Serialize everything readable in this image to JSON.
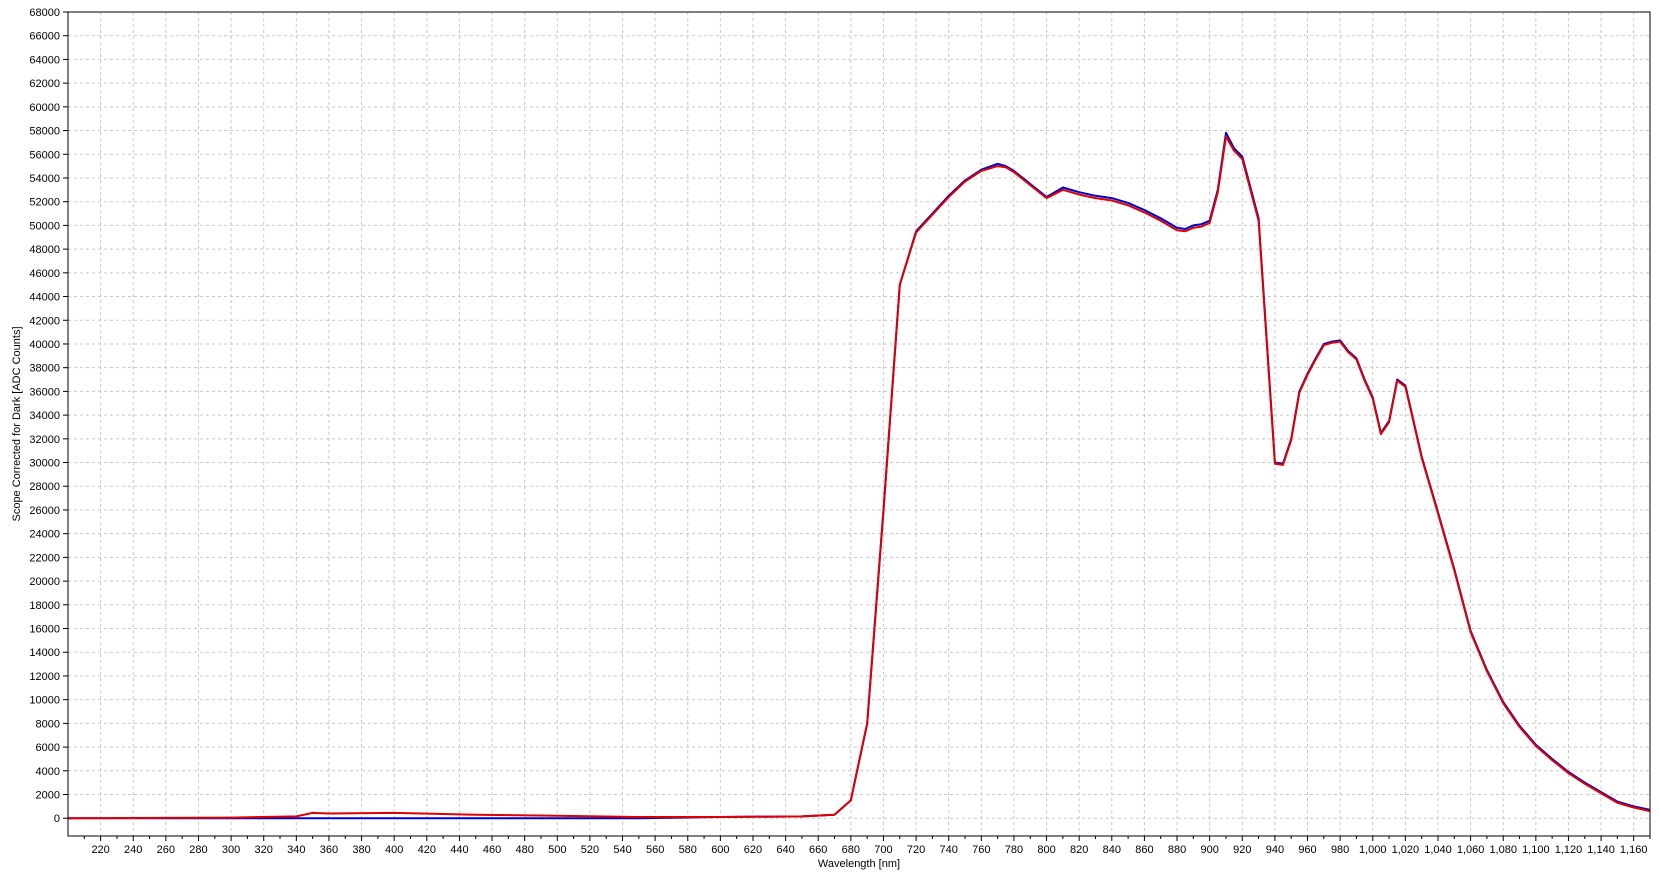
{
  "chart_data": {
    "type": "line",
    "title": "",
    "xlabel": "Wavelength [nm]",
    "ylabel": "Scope Corrected for Dark [ADC Counts]",
    "xlim": [
      200,
      1170
    ],
    "ylim": [
      -1500,
      68000
    ],
    "grid": true,
    "legend": "none",
    "x_ticks": [
      "220",
      "240",
      "260",
      "280",
      "300",
      "320",
      "340",
      "360",
      "380",
      "400",
      "420",
      "440",
      "460",
      "480",
      "500",
      "520",
      "540",
      "560",
      "580",
      "600",
      "620",
      "640",
      "660",
      "680",
      "700",
      "720",
      "740",
      "760",
      "780",
      "800",
      "820",
      "840",
      "860",
      "880",
      "900",
      "920",
      "940",
      "960",
      "980",
      "1,000",
      "1,020",
      "1,040",
      "1,060",
      "1,080",
      "1,100",
      "1,120",
      "1,140",
      "1,160"
    ],
    "y_ticks": [
      "0",
      "2000",
      "4000",
      "6000",
      "8000",
      "10000",
      "12000",
      "14000",
      "16000",
      "18000",
      "20000",
      "22000",
      "24000",
      "26000",
      "28000",
      "30000",
      "32000",
      "34000",
      "36000",
      "38000",
      "40000",
      "42000",
      "44000",
      "46000",
      "48000",
      "50000",
      "52000",
      "54000",
      "56000",
      "58000",
      "60000",
      "62000",
      "64000",
      "66000",
      "68000"
    ],
    "series": [
      {
        "color": "#0000cc",
        "x": [
          200,
          300,
          340,
          350,
          400,
          500,
          550,
          600,
          650,
          670,
          680,
          690,
          700,
          710,
          720,
          730,
          740,
          750,
          760,
          770,
          775,
          780,
          790,
          800,
          810,
          820,
          830,
          840,
          850,
          860,
          870,
          880,
          885,
          890,
          895,
          900,
          905,
          910,
          915,
          920,
          930,
          940,
          945,
          950,
          955,
          960,
          965,
          970,
          975,
          980,
          985,
          990,
          995,
          1000,
          1005,
          1010,
          1015,
          1020,
          1030,
          1040,
          1050,
          1060,
          1070,
          1080,
          1090,
          1100,
          1110,
          1120,
          1130,
          1140,
          1150,
          1160,
          1170
        ],
        "y": [
          0,
          0,
          0,
          0,
          0,
          0,
          0,
          100,
          150,
          300,
          1500,
          8000,
          26000,
          45000,
          49500,
          51000,
          52500,
          53800,
          54700,
          55200,
          55000,
          54600,
          53500,
          52400,
          53200,
          52800,
          52500,
          52300,
          51900,
          51300,
          50600,
          49800,
          49700,
          50000,
          50100,
          50400,
          53000,
          57800,
          56500,
          55800,
          50600,
          30000,
          29900,
          32000,
          36000,
          37500,
          38800,
          40000,
          40200,
          40300,
          39400,
          38800,
          37000,
          35500,
          32500,
          33500,
          37000,
          36500,
          30500,
          25800,
          21000,
          15800,
          12500,
          9800,
          7800,
          6200,
          5000,
          3900,
          3000,
          2200,
          1400,
          1000,
          700
        ]
      },
      {
        "color": "#dd0000",
        "x": [
          200,
          300,
          340,
          350,
          360,
          400,
          450,
          500,
          550,
          600,
          650,
          670,
          680,
          690,
          700,
          710,
          720,
          730,
          740,
          750,
          760,
          770,
          775,
          780,
          790,
          800,
          810,
          820,
          830,
          840,
          850,
          860,
          870,
          880,
          885,
          890,
          895,
          900,
          905,
          910,
          915,
          920,
          930,
          940,
          945,
          950,
          955,
          960,
          965,
          970,
          975,
          980,
          985,
          990,
          995,
          1000,
          1005,
          1010,
          1015,
          1020,
          1030,
          1040,
          1050,
          1060,
          1070,
          1080,
          1090,
          1100,
          1110,
          1120,
          1130,
          1140,
          1150,
          1160,
          1170
        ],
        "y": [
          0,
          50,
          150,
          450,
          400,
          450,
          300,
          200,
          100,
          100,
          150,
          300,
          1500,
          8000,
          26000,
          45000,
          49400,
          50900,
          52400,
          53700,
          54600,
          55000,
          54900,
          54500,
          53400,
          52300,
          53000,
          52600,
          52300,
          52100,
          51700,
          51100,
          50400,
          49600,
          49500,
          49800,
          49900,
          50200,
          52800,
          57500,
          56300,
          55600,
          50400,
          29900,
          29800,
          31900,
          35900,
          37400,
          38700,
          39900,
          40100,
          40200,
          39300,
          38700,
          36900,
          35400,
          32400,
          33400,
          36900,
          36400,
          30400,
          25700,
          20900,
          15700,
          12400,
          9700,
          7700,
          6100,
          4900,
          3800,
          2900,
          2100,
          1300,
          900,
          600
        ]
      }
    ]
  }
}
